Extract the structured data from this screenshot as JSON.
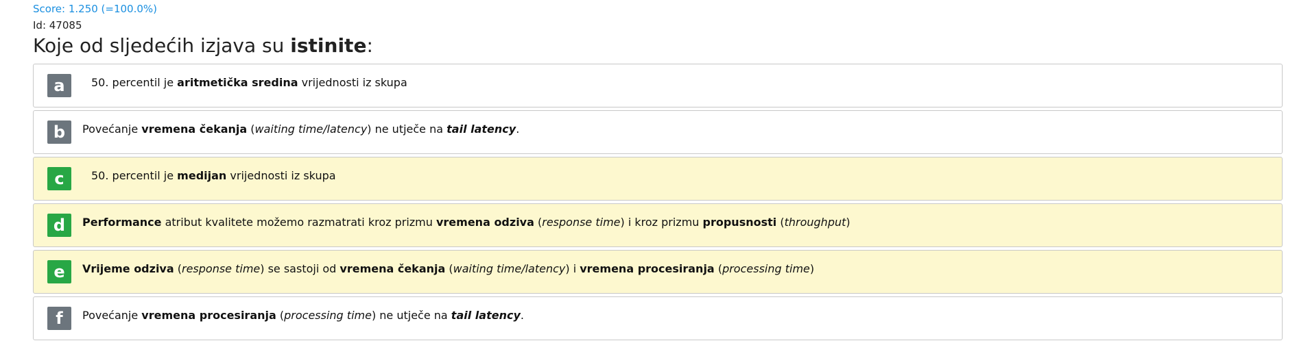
{
  "header": {
    "score": "Score: 1.250 (=100.0%)",
    "id": "Id: 47085"
  },
  "question": {
    "title_prefix": "Koje od sljedećih izjava su ",
    "title_bold": "istinite",
    "title_suffix": ":"
  },
  "answers": [
    {
      "letter": "a",
      "correct": false,
      "parts": [
        {
          "text": "50. percentil je ",
          "style": "normal"
        },
        {
          "text": "aritmetička sredina",
          "style": "bold"
        },
        {
          "text": " vrijednosti iz skupa",
          "style": "normal"
        }
      ]
    },
    {
      "letter": "b",
      "correct": false,
      "parts": [
        {
          "text": "Povećanje ",
          "style": "normal"
        },
        {
          "text": "vremena čekanja",
          "style": "bold"
        },
        {
          "text": " (",
          "style": "normal"
        },
        {
          "text": "waiting time/latency",
          "style": "italic"
        },
        {
          "text": ") ne utječe na ",
          "style": "normal"
        },
        {
          "text": "tail latency",
          "style": "bolditalic"
        },
        {
          "text": ".",
          "style": "normal"
        }
      ]
    },
    {
      "letter": "c",
      "correct": true,
      "parts": [
        {
          "text": "50. percentil je ",
          "style": "normal"
        },
        {
          "text": "medijan",
          "style": "bold"
        },
        {
          "text": " vrijednosti iz skupa",
          "style": "normal"
        }
      ]
    },
    {
      "letter": "d",
      "correct": true,
      "parts": [
        {
          "text": "Performance",
          "style": "bold"
        },
        {
          "text": " atribut kvalitete možemo razmatrati kroz prizmu ",
          "style": "normal"
        },
        {
          "text": "vremena odziva",
          "style": "bold"
        },
        {
          "text": " (",
          "style": "normal"
        },
        {
          "text": "response time",
          "style": "italic"
        },
        {
          "text": ") i kroz prizmu ",
          "style": "normal"
        },
        {
          "text": "propusnosti",
          "style": "bold"
        },
        {
          "text": " (",
          "style": "normal"
        },
        {
          "text": "throughput",
          "style": "italic"
        },
        {
          "text": ")",
          "style": "normal"
        }
      ]
    },
    {
      "letter": "e",
      "correct": true,
      "parts": [
        {
          "text": "Vrijeme odziva",
          "style": "bold"
        },
        {
          "text": " (",
          "style": "normal"
        },
        {
          "text": "response time",
          "style": "italic"
        },
        {
          "text": ") se sastoji od ",
          "style": "normal"
        },
        {
          "text": "vremena čekanja",
          "style": "bold"
        },
        {
          "text": " (",
          "style": "normal"
        },
        {
          "text": "waiting time/latency",
          "style": "italic"
        },
        {
          "text": ") i ",
          "style": "normal"
        },
        {
          "text": "vremena procesiranja",
          "style": "bold"
        },
        {
          "text": " (",
          "style": "normal"
        },
        {
          "text": "processing time",
          "style": "italic"
        },
        {
          "text": ")",
          "style": "normal"
        }
      ]
    },
    {
      "letter": "f",
      "correct": false,
      "parts": [
        {
          "text": "Povećanje ",
          "style": "normal"
        },
        {
          "text": "vremena procesiranja",
          "style": "bold"
        },
        {
          "text": " (",
          "style": "normal"
        },
        {
          "text": "processing time",
          "style": "italic"
        },
        {
          "text": ") ne utječe na ",
          "style": "normal"
        },
        {
          "text": "tail latency",
          "style": "bolditalic"
        },
        {
          "text": ".",
          "style": "normal"
        }
      ]
    }
  ],
  "colors": {
    "score_link": "#1a8fe0",
    "correct_background": "#fdf8cf",
    "correct_badge": "#28a745",
    "neutral_badge": "#6c757d"
  }
}
